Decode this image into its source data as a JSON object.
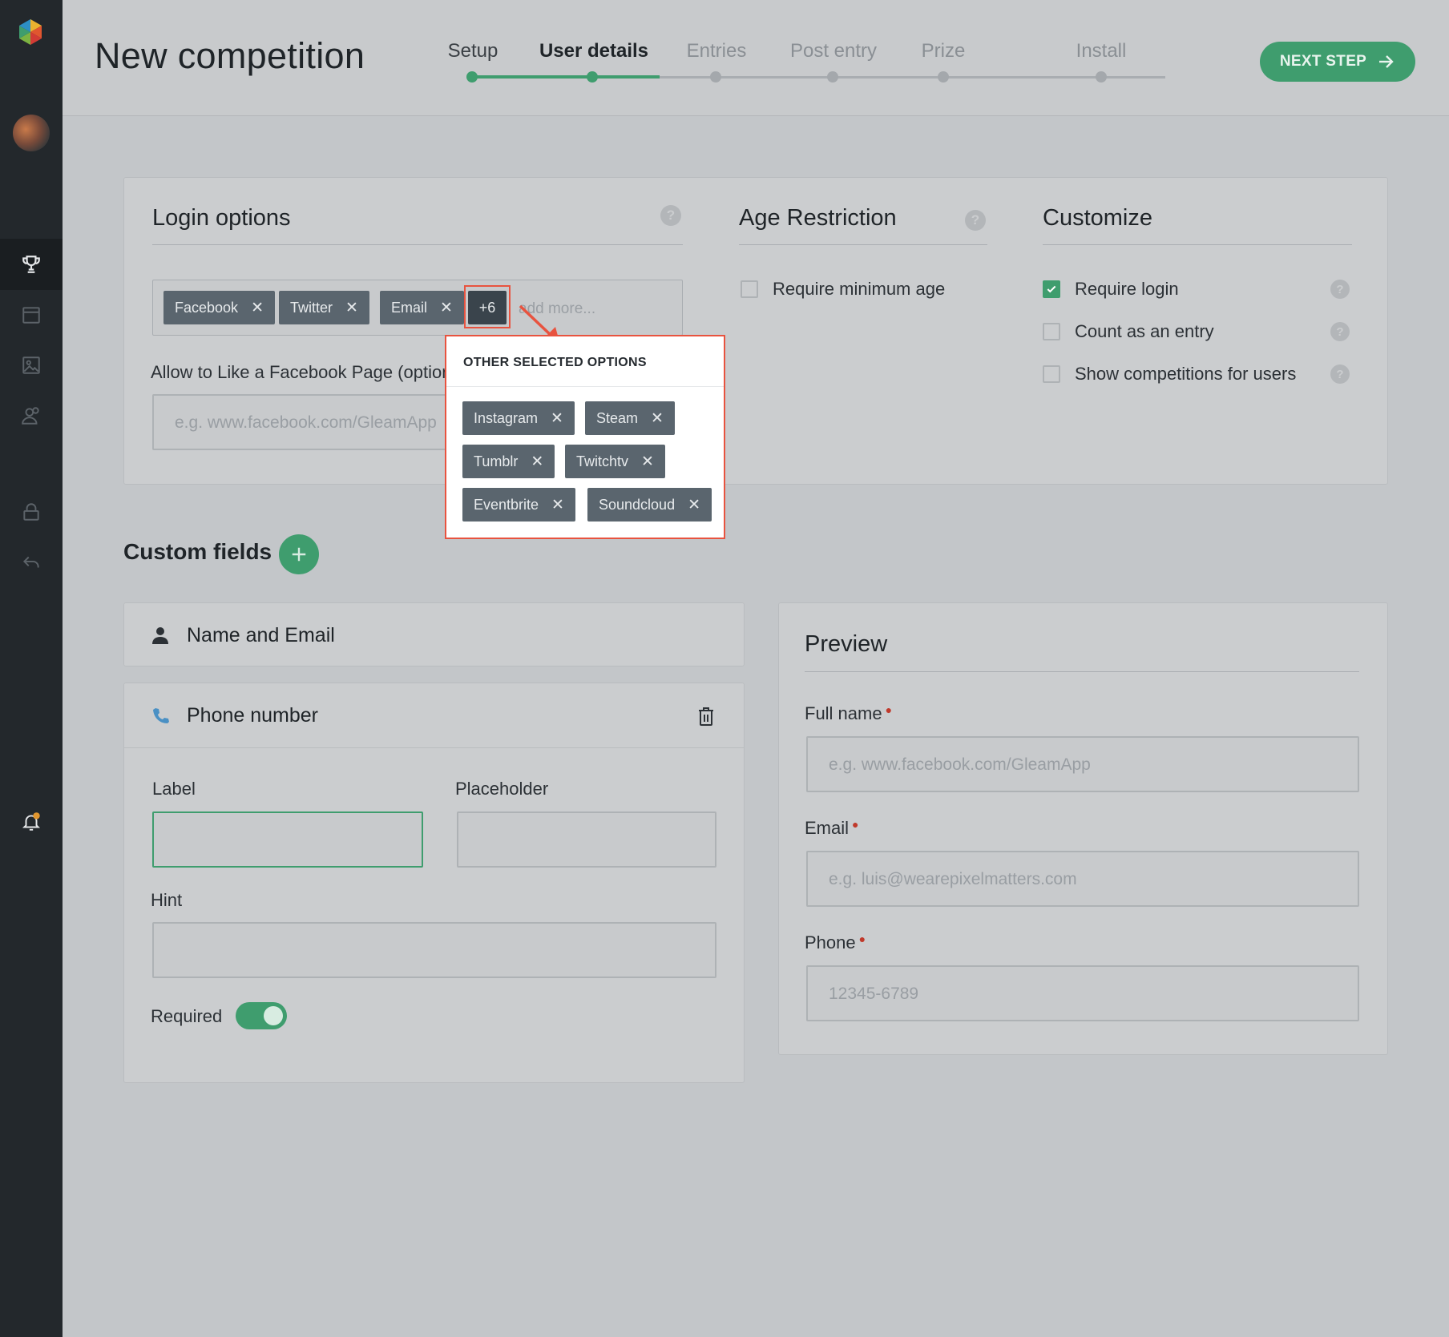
{
  "app": {
    "title": "New competition",
    "next_step_label": "NEXT STEP"
  },
  "steps": [
    {
      "label": "Setup",
      "state": "done"
    },
    {
      "label": "User details",
      "state": "current"
    },
    {
      "label": "Entries",
      "state": "todo"
    },
    {
      "label": "Post entry",
      "state": "todo"
    },
    {
      "label": "Prize",
      "state": "todo"
    },
    {
      "label": "Install",
      "state": "todo"
    }
  ],
  "sidebar": {
    "items": [
      {
        "name": "trophy-icon",
        "active": true
      },
      {
        "name": "calendar-icon",
        "active": false
      },
      {
        "name": "image-icon",
        "active": false
      },
      {
        "name": "users-icon",
        "active": false
      },
      {
        "name": "lock-icon",
        "active": false
      },
      {
        "name": "logout-icon",
        "active": false
      },
      {
        "name": "bell-icon",
        "active": false
      }
    ]
  },
  "login_options": {
    "title": "Login options",
    "help": "?",
    "tags": [
      "Facebook",
      "Twitter",
      "Email"
    ],
    "more_count": "+6",
    "add_more_placeholder": "add more...",
    "facebook_page_label": "Allow to Like a Facebook Page (optional)",
    "facebook_page_placeholder": "e.g. www.facebook.com/GleamApp"
  },
  "popover": {
    "title": "OTHER SELECTED OPTIONS",
    "tags": [
      "Instagram",
      "Steam",
      "Tumblr",
      "Twitchtv",
      "Eventbrite",
      "Soundcloud"
    ]
  },
  "age_restriction": {
    "title": "Age Restriction",
    "help": "?",
    "require_min_age": {
      "label": "Require minimum age",
      "checked": false
    }
  },
  "customize": {
    "title": "Customize",
    "options": [
      {
        "label": "Require login",
        "checked": true,
        "help": "?"
      },
      {
        "label": "Count as an entry",
        "checked": false,
        "help": "?"
      },
      {
        "label": "Show competitions for users",
        "checked": false,
        "help": "?"
      }
    ]
  },
  "custom_fields": {
    "title": "Custom fields",
    "name_email": {
      "label": "Name and Email"
    },
    "phone": {
      "label": "Phone number",
      "label_field": "Label",
      "label_value": "",
      "placeholder_field": "Placeholder",
      "placeholder_value": "",
      "hint_field": "Hint",
      "hint_value": "",
      "required_label": "Required",
      "required": true
    }
  },
  "preview": {
    "title": "Preview",
    "fields": [
      {
        "label": "Full name",
        "required": true,
        "placeholder": "e.g. www.facebook.com/GleamApp"
      },
      {
        "label": "Email",
        "required": true,
        "placeholder": "e.g. luis@wearepixelmatters.com"
      },
      {
        "label": "Phone",
        "required": true,
        "placeholder": "12345-6789"
      }
    ]
  },
  "colors": {
    "accent": "#3f9d6e",
    "sidebar": "#23282c",
    "highlight": "#e8533f",
    "tag": "#5a656e"
  }
}
